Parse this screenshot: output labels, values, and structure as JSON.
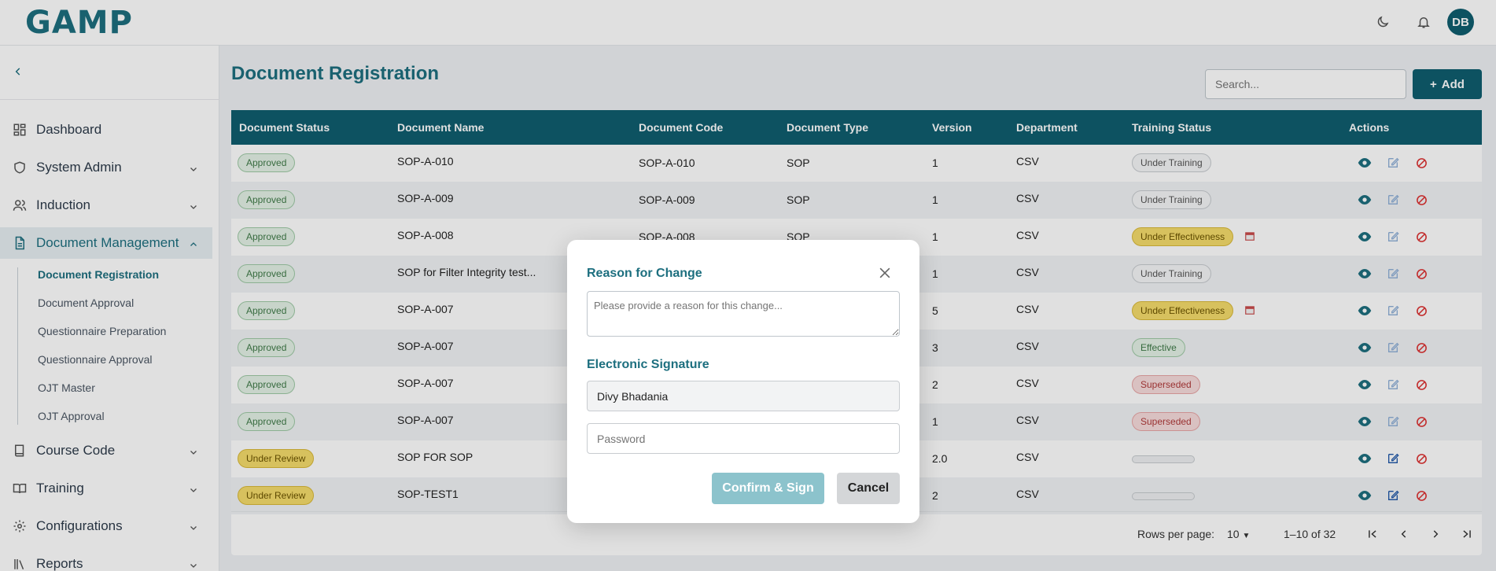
{
  "header": {
    "logo_text": "GAMP",
    "user_initials": "DB"
  },
  "sidebar": {
    "items": [
      {
        "label": "Dashboard",
        "icon": "dashboard-icon"
      },
      {
        "label": "System Admin",
        "icon": "shield-icon"
      },
      {
        "label": "Induction",
        "icon": "users-icon"
      },
      {
        "label": "Document Management",
        "icon": "document-icon"
      },
      {
        "label": "Course Code",
        "icon": "book-icon"
      },
      {
        "label": "Training",
        "icon": "open-book-icon"
      },
      {
        "label": "Configurations",
        "icon": "gear-icon"
      },
      {
        "label": "Reports",
        "icon": "reports-icon"
      }
    ],
    "sub_items": [
      "Document Registration",
      "Document Approval",
      "Questionnaire Preparation",
      "Questionnaire Approval",
      "OJT Master",
      "OJT Approval"
    ]
  },
  "main": {
    "title": "Document Registration",
    "search_placeholder": "Search...",
    "add_label": "Add"
  },
  "table": {
    "columns": [
      "Document Status",
      "Document Name",
      "Document Code",
      "Document Type",
      "Version",
      "Department",
      "Training Status",
      "Actions"
    ],
    "rows": [
      {
        "status": "Approved",
        "name": "SOP-A-010",
        "code": "SOP-A-010",
        "type": "SOP",
        "version": "1",
        "dept": "CSV",
        "training": "Under Training"
      },
      {
        "status": "Approved",
        "name": "SOP-A-009",
        "code": "SOP-A-009",
        "type": "SOP",
        "version": "1",
        "dept": "CSV",
        "training": "Under Training"
      },
      {
        "status": "Approved",
        "name": "SOP-A-008",
        "code": "SOP-A-008",
        "type": "SOP",
        "version": "1",
        "dept": "CSV",
        "training": "Under Effectiveness"
      },
      {
        "status": "Approved",
        "name": "SOP for Filter Integrity test...",
        "code": "",
        "type": "",
        "version": "1",
        "dept": "CSV",
        "training": "Under Training"
      },
      {
        "status": "Approved",
        "name": "SOP-A-007",
        "code": "",
        "type": "",
        "version": "5",
        "dept": "CSV",
        "training": "Under Effectiveness"
      },
      {
        "status": "Approved",
        "name": "SOP-A-007",
        "code": "",
        "type": "",
        "version": "3",
        "dept": "CSV",
        "training": "Effective"
      },
      {
        "status": "Approved",
        "name": "SOP-A-007",
        "code": "",
        "type": "",
        "version": "2",
        "dept": "CSV",
        "training": "Superseded"
      },
      {
        "status": "Approved",
        "name": "SOP-A-007",
        "code": "",
        "type": "",
        "version": "1",
        "dept": "CSV",
        "training": "Superseded"
      },
      {
        "status": "Under Review",
        "name": "SOP FOR SOP",
        "code": "",
        "type": "",
        "version": "2.0",
        "dept": "CSV",
        "training": ""
      },
      {
        "status": "Under Review",
        "name": "SOP-TEST1",
        "code": "",
        "type": "",
        "version": "2",
        "dept": "CSV",
        "training": ""
      }
    ]
  },
  "pagination": {
    "rows_per_page_label": "Rows per page:",
    "rows_per_page_value": "10",
    "range": "1–10 of 32"
  },
  "modal": {
    "title": "Reason for Change",
    "reason_placeholder": "Please provide a reason for this change...",
    "signature_title": "Electronic Signature",
    "signer_name": "Divy Bhadania",
    "password_placeholder": "Password",
    "confirm_label": "Confirm & Sign",
    "cancel_label": "Cancel"
  },
  "colors": {
    "primary": "#0f5e6f",
    "accent_text": "#1d6f7f",
    "approved_bg": "#e4f2e6",
    "review_bg": "#f5dc6b",
    "superseded_bg": "#f8dcdc"
  }
}
